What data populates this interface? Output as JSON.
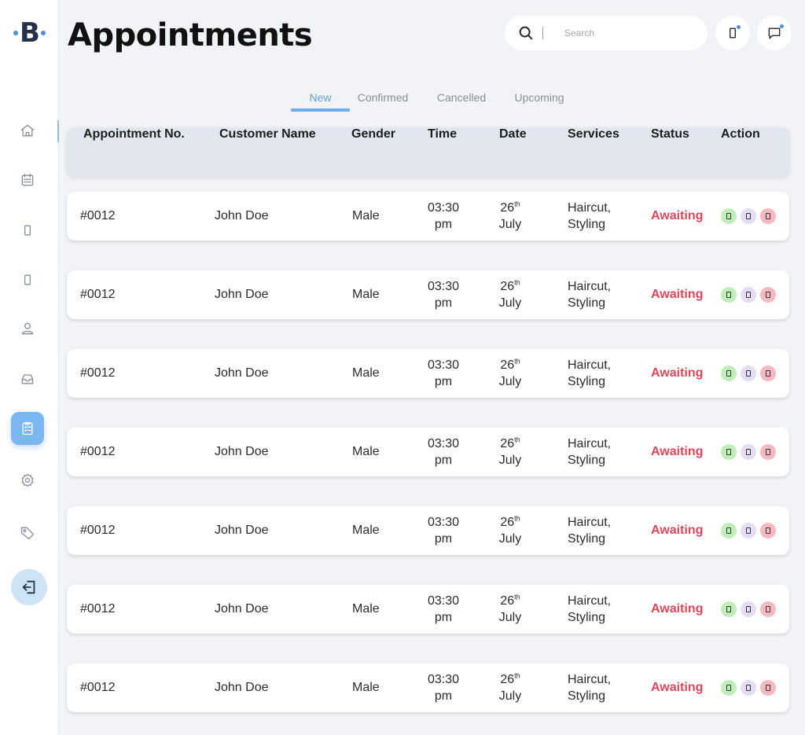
{
  "brand": {
    "logo_text": "B"
  },
  "header": {
    "title": "Appointments",
    "search_placeholder": "Search"
  },
  "sidebar": {
    "items": [
      {
        "name": "home-icon"
      },
      {
        "name": "calendar-list-icon"
      },
      {
        "name": "phone-icon"
      },
      {
        "name": "phone-icon"
      },
      {
        "name": "user-icon"
      },
      {
        "name": "inbox-icon"
      },
      {
        "name": "clipboard-list-icon",
        "active": true
      },
      {
        "name": "settings-icon"
      },
      {
        "name": "tag-icon"
      }
    ],
    "logout": "logout-icon"
  },
  "tabs": [
    {
      "label": "New",
      "active": true
    },
    {
      "label": "Confirmed"
    },
    {
      "label": "Cancelled"
    },
    {
      "label": "Upcoming"
    }
  ],
  "table": {
    "columns": [
      "Appointment No.",
      "Customer Name",
      "Gender",
      "Time",
      "Date",
      "Services",
      "Status",
      "Action"
    ],
    "rows": [
      {
        "no": "#0012",
        "customer": "John Doe",
        "gender": "Male",
        "time_1": "03:30",
        "time_2": "pm",
        "day": "26",
        "day_suffix": "th",
        "month": "July",
        "service_1": "Haircut,",
        "service_2": "Styling",
        "status": "Awaiting"
      },
      {
        "no": "#0012",
        "customer": "John Doe",
        "gender": "Male",
        "time_1": "03:30",
        "time_2": "pm",
        "day": "26",
        "day_suffix": "th",
        "month": "July",
        "service_1": "Haircut,",
        "service_2": "Styling",
        "status": "Awaiting"
      },
      {
        "no": "#0012",
        "customer": "John Doe",
        "gender": "Male",
        "time_1": "03:30",
        "time_2": "pm",
        "day": "26",
        "day_suffix": "th",
        "month": "July",
        "service_1": "Haircut,",
        "service_2": "Styling",
        "status": "Awaiting"
      },
      {
        "no": "#0012",
        "customer": "John Doe",
        "gender": "Male",
        "time_1": "03:30",
        "time_2": "pm",
        "day": "26",
        "day_suffix": "th",
        "month": "July",
        "service_1": "Haircut,",
        "service_2": "Styling",
        "status": "Awaiting"
      },
      {
        "no": "#0012",
        "customer": "John Doe",
        "gender": "Male",
        "time_1": "03:30",
        "time_2": "pm",
        "day": "26",
        "day_suffix": "th",
        "month": "July",
        "service_1": "Haircut,",
        "service_2": "Styling",
        "status": "Awaiting"
      },
      {
        "no": "#0012",
        "customer": "John Doe",
        "gender": "Male",
        "time_1": "03:30",
        "time_2": "pm",
        "day": "26",
        "day_suffix": "th",
        "month": "July",
        "service_1": "Haircut,",
        "service_2": "Styling",
        "status": "Awaiting"
      },
      {
        "no": "#0012",
        "customer": "John Doe",
        "gender": "Male",
        "time_1": "03:30",
        "time_2": "pm",
        "day": "26",
        "day_suffix": "th",
        "month": "July",
        "service_1": "Haircut,",
        "service_2": "Styling",
        "status": "Awaiting"
      }
    ]
  },
  "colors": {
    "accent": "#6aaef0",
    "status_awaiting": "#e0475a",
    "action_accept": "#bfeeb8",
    "action_view": "#e6dcf5",
    "action_reject": "#f7b9c1"
  }
}
